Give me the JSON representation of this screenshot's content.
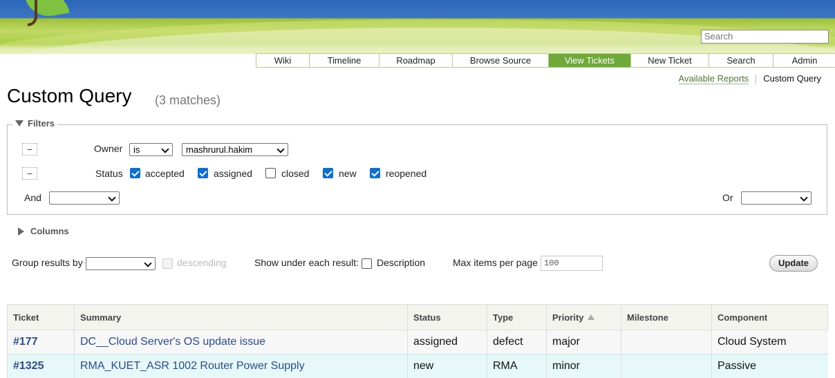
{
  "header": {
    "search_placeholder": "Search"
  },
  "nav": [
    {
      "label": "Wiki",
      "active": false
    },
    {
      "label": "Timeline",
      "active": false
    },
    {
      "label": "Roadmap",
      "active": false
    },
    {
      "label": "Browse Source",
      "active": false
    },
    {
      "label": "View Tickets",
      "active": true
    },
    {
      "label": "New Ticket",
      "active": false
    },
    {
      "label": "Search",
      "active": false
    },
    {
      "label": "Admin",
      "active": false
    }
  ],
  "context_nav": {
    "available_reports": "Available Reports",
    "custom_query": "Custom Query"
  },
  "page": {
    "title": "Custom Query",
    "matches": "(3 matches)"
  },
  "filters": {
    "legend": "Filters",
    "remove_label": "–",
    "owner": {
      "label": "Owner",
      "mode": "is",
      "value": "mashrurul.hakim"
    },
    "status": {
      "label": "Status",
      "options": [
        {
          "label": "accepted",
          "checked": true
        },
        {
          "label": "assigned",
          "checked": true
        },
        {
          "label": "closed",
          "checked": false
        },
        {
          "label": "new",
          "checked": true
        },
        {
          "label": "reopened",
          "checked": true
        }
      ]
    },
    "and_label": "And",
    "or_label": "Or"
  },
  "columns_label": "Columns",
  "options": {
    "group_label": "Group results by",
    "descending_label": "descending",
    "show_under_label": "Show under each result:",
    "description_label": "Description",
    "max_items_label": "Max items per page",
    "max_items_value": "100",
    "update_label": "Update"
  },
  "table": {
    "headers": [
      "Ticket",
      "Summary",
      "Status",
      "Type",
      "Priority",
      "Milestone",
      "Component"
    ],
    "rows": [
      {
        "ticket": "#177",
        "summary": "DC__Cloud Server's OS update issue",
        "status": "assigned",
        "type": "defect",
        "priority": "major",
        "milestone": "",
        "component": "Cloud System"
      },
      {
        "ticket": "#1325",
        "summary": "RMA_KUET_ASR 1002 Router Power Supply",
        "status": "new",
        "type": "RMA",
        "priority": "minor",
        "milestone": "",
        "component": "Passive"
      }
    ]
  },
  "colors": {
    "nav_active": "#6ea93a",
    "link": "#2a4b91",
    "checkbox": "#0b6fd8"
  }
}
